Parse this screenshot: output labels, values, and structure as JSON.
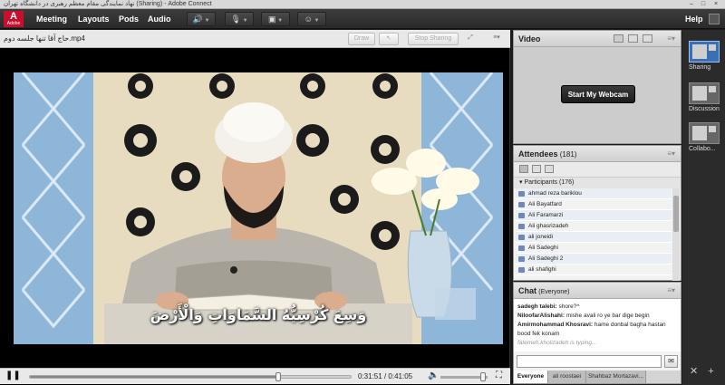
{
  "window": {
    "title": "نهاد نمایندگی مقام معظم رهبری در دانشگاه تهران (Sharing) - Adobe Connect",
    "controls": [
      "–",
      "□",
      "×"
    ]
  },
  "menubar": {
    "logo_text": "A",
    "logo_sub": "Adobe",
    "items": [
      "Meeting",
      "Layouts",
      "Pods",
      "Audio"
    ],
    "help": "Help",
    "icons": [
      "speaker-icon",
      "microphone-icon",
      "webcam-icon",
      "user-status-icon"
    ]
  },
  "share": {
    "title": "حاج آقا تنها جلسه دوم.mp4",
    "draw_label": "Draw",
    "stop_sharing_label": "Stop Sharing"
  },
  "video": {
    "subtitle": "وَسِعَ كُرْسِيُّهُ السَّمَاوَاتِ وَالْأَرْضَ"
  },
  "player": {
    "current_time": "0:31:51",
    "separator": "/",
    "total_time": "0:41:05",
    "progress": 0.775,
    "volume": 0.9
  },
  "video_pod": {
    "title": "Video",
    "webcam_button": "Start My Webcam"
  },
  "attendees": {
    "title": "Attendees",
    "count": "(181)",
    "participants_header": "Participants (176)",
    "list": [
      "ahmad reza bariklou",
      "Ali Bayatfard",
      "Ali Faramarzi",
      "Ali ghasrizadeh",
      "ali joneidi",
      "Ali Sadeghi",
      "Ali Sadeghi 2",
      "ali shafighi"
    ]
  },
  "chat": {
    "title": "Chat",
    "scope": "(Everyone)",
    "messages": [
      {
        "author": "sadegh talebi:",
        "text": " shore?^"
      },
      {
        "author": "NiloofarAlishahi:",
        "text": " mishe avali ro ye bar dige begin"
      },
      {
        "author": "Amirmohammad Khosravi:",
        "text": " hame donbal bagha hastan bood fek konam"
      }
    ],
    "typing": "fatemeh.kholizadeh is typing...",
    "tabs": [
      "Everyone",
      "ali roostaei",
      "Shahbaz Mortazavi..."
    ]
  },
  "layouts": {
    "items": [
      "Sharing",
      "Discussion",
      "Collabo..."
    ]
  },
  "colors": {
    "accent_green": "#3ec43e",
    "adobe_red": "#c8102e",
    "layout_active": "#3b6fb3"
  }
}
